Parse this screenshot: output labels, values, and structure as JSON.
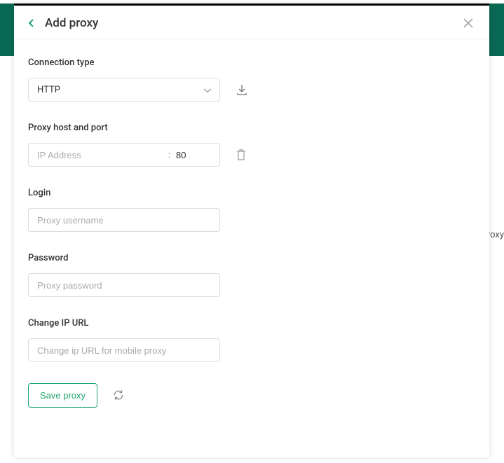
{
  "modal": {
    "title": "Add proxy",
    "backdrop_hint": "roxy"
  },
  "form": {
    "connection_type": {
      "label": "Connection type",
      "value": "HTTP"
    },
    "host_port": {
      "label": "Proxy host and port",
      "host_placeholder": "IP Address",
      "host_value": "",
      "port_value": "80",
      "separator": ":"
    },
    "login": {
      "label": "Login",
      "placeholder": "Proxy username",
      "value": ""
    },
    "password": {
      "label": "Password",
      "placeholder": "Proxy password",
      "value": ""
    },
    "change_ip": {
      "label": "Change IP URL",
      "placeholder": "Change ip URL for mobile proxy",
      "value": ""
    },
    "save_label": "Save proxy"
  }
}
